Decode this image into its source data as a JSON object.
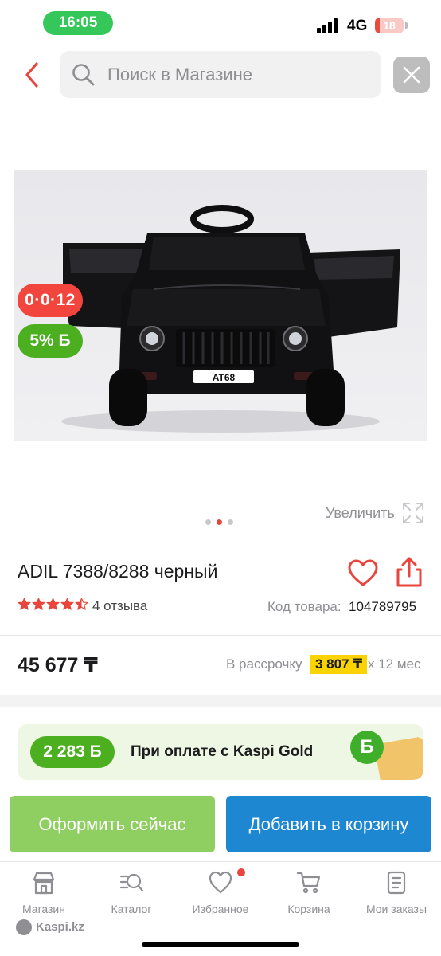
{
  "status_bar": {
    "time": "16:05",
    "network": "4G",
    "battery": "18",
    "battery_level": 0.18
  },
  "search": {
    "placeholder": "Поиск в Магазине"
  },
  "gallery": {
    "image_alt": "black ride-on toy car with AT68 plate",
    "plate_text": "AT68",
    "installment_badge": "0·0·12",
    "bonus_badge": "5% Б",
    "zoom_label": "Увеличить",
    "slides_count": 3,
    "active_slide": 2
  },
  "product": {
    "title": "ADIL 7388/8288 черный",
    "rating": 4.5,
    "reviews": "4 отзыва",
    "code_label": "Код товара:",
    "code_value": "104789795",
    "price": "45 677 ₸",
    "installment_label": "В рассрочку",
    "installment_value": "3 807 ₸",
    "installment_term": "x 12 мес"
  },
  "promo": {
    "amount": "2 283 Б",
    "text": "При оплате с Kaspi Gold",
    "coin_symbol": "Б"
  },
  "actions": {
    "buy_now": "Оформить сейчас",
    "add_to_cart": "Добавить в корзину"
  },
  "bottom_nav": {
    "items": [
      {
        "label": "Магазин",
        "icon": "shop-icon"
      },
      {
        "label": "Каталог",
        "icon": "catalog-icon"
      },
      {
        "label": "Избранное",
        "icon": "heart-icon"
      },
      {
        "label": "Корзина",
        "icon": "cart-icon"
      },
      {
        "label": "Мои заказы",
        "icon": "orders-icon"
      }
    ],
    "brand": "Kaspi.kz"
  },
  "colors": {
    "accent_red": "#f1453d",
    "bonus_green": "#4caf20",
    "buy_button": "#8fcf62",
    "cart_button": "#1e87d2",
    "installment_highlight": "#fbd400"
  }
}
